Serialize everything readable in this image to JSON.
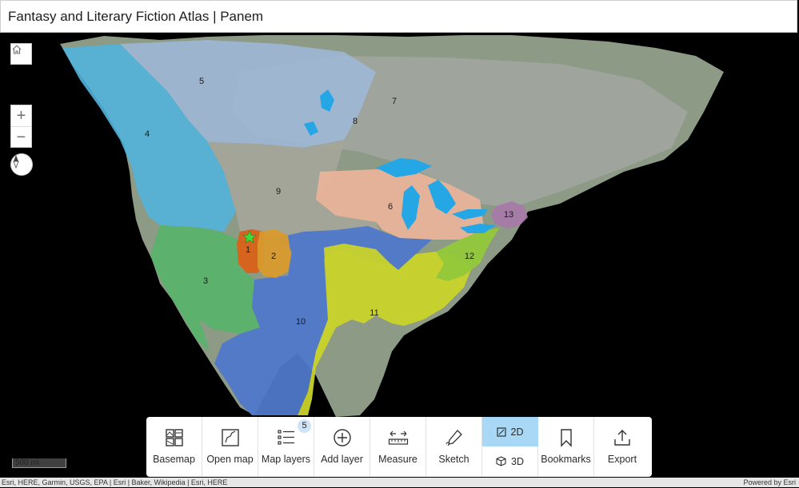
{
  "header": {
    "title": "Fantasy and Literary Fiction Atlas | Panem"
  },
  "map_controls": {
    "home": "home-icon",
    "zoom_in": "+",
    "zoom_out": "−",
    "compass": "compass-icon"
  },
  "districts": [
    {
      "label": "1",
      "color": "#d4641e"
    },
    {
      "label": "2",
      "color": "#d99a2c"
    },
    {
      "label": "3",
      "color": "#57b46a"
    },
    {
      "label": "4",
      "color": "#52b3dc"
    },
    {
      "label": "5",
      "color": "#9fb9d9"
    },
    {
      "label": "6",
      "color": "#e9b39a"
    },
    {
      "label": "7",
      "color": "#a9a9a9"
    },
    {
      "label": "8",
      "color": "#a9a9a9"
    },
    {
      "label": "9",
      "color": "#a5a69a"
    },
    {
      "label": "10",
      "color": "#4f78c9"
    },
    {
      "label": "11",
      "color": "#c9d32a"
    },
    {
      "label": "12",
      "color": "#93c83b"
    },
    {
      "label": "13",
      "color": "#a77aa6"
    }
  ],
  "capitol_marker": "star-icon",
  "scale": "500 mi",
  "attribution": {
    "left": "Esri, HERE, Garmin, USGS, EPA | Esri | Baker, Wikipedia | Esri, HERE",
    "right": "Powered by Esri"
  },
  "toolbar": {
    "basemap": "Basemap",
    "open_map": "Open map",
    "map_layers": "Map layers",
    "map_layers_count": "5",
    "add_layer": "Add layer",
    "measure": "Measure",
    "sketch": "Sketch",
    "view_2d": "2D",
    "view_3d": "3D",
    "active_view": "2D",
    "bookmarks": "Bookmarks",
    "export": "Export"
  }
}
